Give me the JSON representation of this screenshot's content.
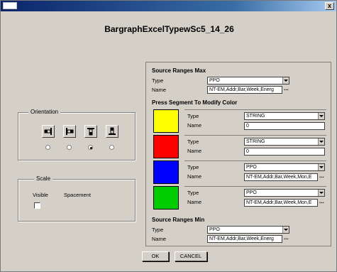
{
  "dialog": {
    "title": "BargraphExcelTypewSc5_14_26",
    "close_glyph": "x"
  },
  "orientation": {
    "label": "Orientation",
    "buttons": [
      "bar-left-icon",
      "bar-right-icon",
      "bar-up-icon",
      "bar-down-icon"
    ],
    "selected_index": 2
  },
  "scale": {
    "label": "Scale",
    "visible_label": "Visible",
    "spacement_label": "Spacement",
    "visible_checked": false
  },
  "source_max": {
    "title": "Source Ranges Max",
    "type_label": "Type",
    "type_value": "PPO",
    "name_label": "Name",
    "name_value": "NT-EM,Addr,Bar,Week,Energ",
    "browse": "..."
  },
  "segments": {
    "title": "Press Segment To Modify Color",
    "items": [
      {
        "color": "#ffff00",
        "type_label": "Type",
        "type_value": "STRING",
        "name_label": "Name",
        "name_value": "0",
        "browse": ""
      },
      {
        "color": "#ff0000",
        "type_label": "Type",
        "type_value": "STRING",
        "name_label": "Name",
        "name_value": "0",
        "browse": ""
      },
      {
        "color": "#0000ff",
        "type_label": "Type",
        "type_value": "PPO",
        "name_label": "Name",
        "name_value": "NT-EM,Addr,Bar,Week,Mon,E",
        "browse": "..."
      },
      {
        "color": "#00cc00",
        "type_label": "Type",
        "type_value": "PPO",
        "name_label": "Name",
        "name_value": "NT-EM,Addr,Bar,Week,Mon,E",
        "browse": "..."
      }
    ]
  },
  "source_min": {
    "title": "Source Ranges Min",
    "type_label": "Type",
    "type_value": "PPO",
    "name_label": "Name",
    "name_value": "NT-EM,Addr,Bar,Week,Energ",
    "browse": "..."
  },
  "buttons": {
    "ok": "OK",
    "cancel": "CANCEL"
  }
}
